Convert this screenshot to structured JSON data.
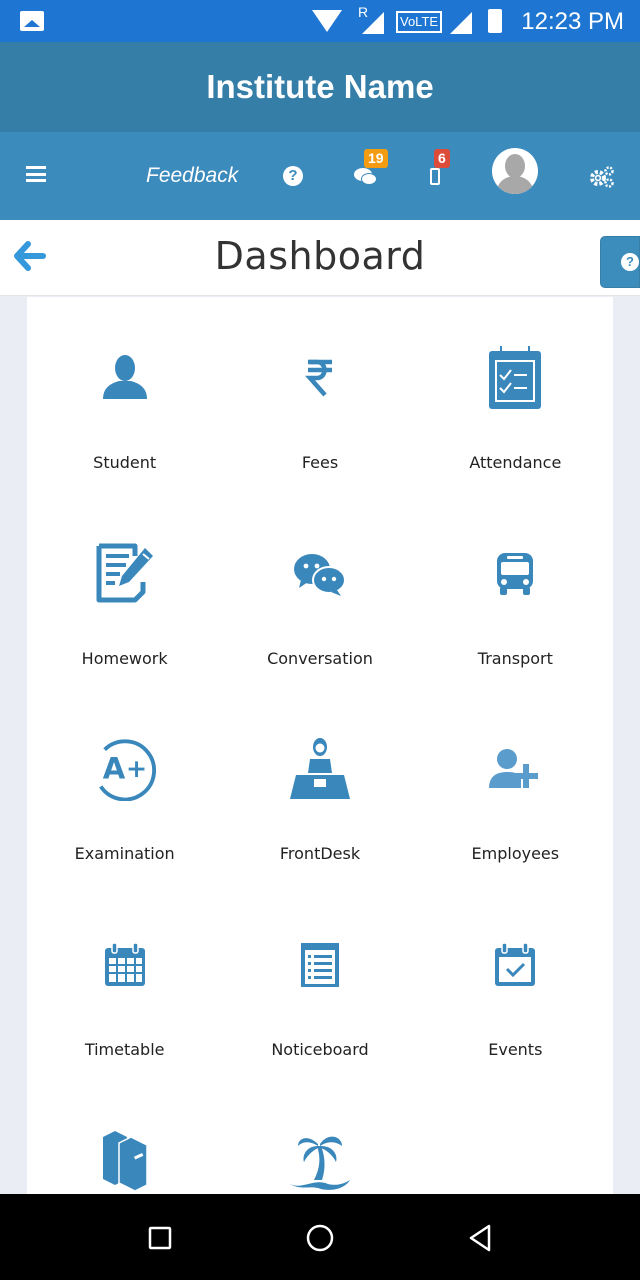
{
  "status_bar": {
    "time": "12:23 PM",
    "network_label": "VoLTE",
    "roaming_label": "R",
    "icons": [
      "gallery-icon",
      "wifi-icon",
      "roaming-signal-icon",
      "volte-icon",
      "signal-icon",
      "battery-icon"
    ]
  },
  "app_header": {
    "title": "Institute Name"
  },
  "toolbar": {
    "menu_icon": "hamburger-icon",
    "feedback_label": "Feedback",
    "help_glyph": "?",
    "messages_badge": "19",
    "notifications_badge": "6",
    "colors": {
      "messages_badge": "#f39c12",
      "notifications_badge": "#dd4b39"
    }
  },
  "page": {
    "title": "Dashboard",
    "help_glyph": "?"
  },
  "dashboard": {
    "accent_color": "#3a87bb",
    "tiles": [
      {
        "label": "Student",
        "icon": "user-icon"
      },
      {
        "label": "Fees",
        "icon": "rupee-icon"
      },
      {
        "label": "Attendance",
        "icon": "attendance-checklist-icon"
      },
      {
        "label": "Homework",
        "icon": "homework-edit-icon"
      },
      {
        "label": "Conversation",
        "icon": "chat-bubbles-icon"
      },
      {
        "label": "Transport",
        "icon": "bus-icon"
      },
      {
        "label": "Examination",
        "icon": "grade-a-plus-icon"
      },
      {
        "label": "FrontDesk",
        "icon": "receptionist-icon"
      },
      {
        "label": "Employees",
        "icon": "add-user-icon"
      },
      {
        "label": "Timetable",
        "icon": "calendar-grid-icon"
      },
      {
        "label": "Noticeboard",
        "icon": "notice-list-icon"
      },
      {
        "label": "Events",
        "icon": "calendar-check-icon"
      },
      {
        "label": "",
        "icon": "books-icon"
      },
      {
        "label": "",
        "icon": "palm-tree-icon"
      }
    ]
  },
  "nav_bar": {
    "buttons": [
      "recents",
      "home",
      "back"
    ]
  }
}
